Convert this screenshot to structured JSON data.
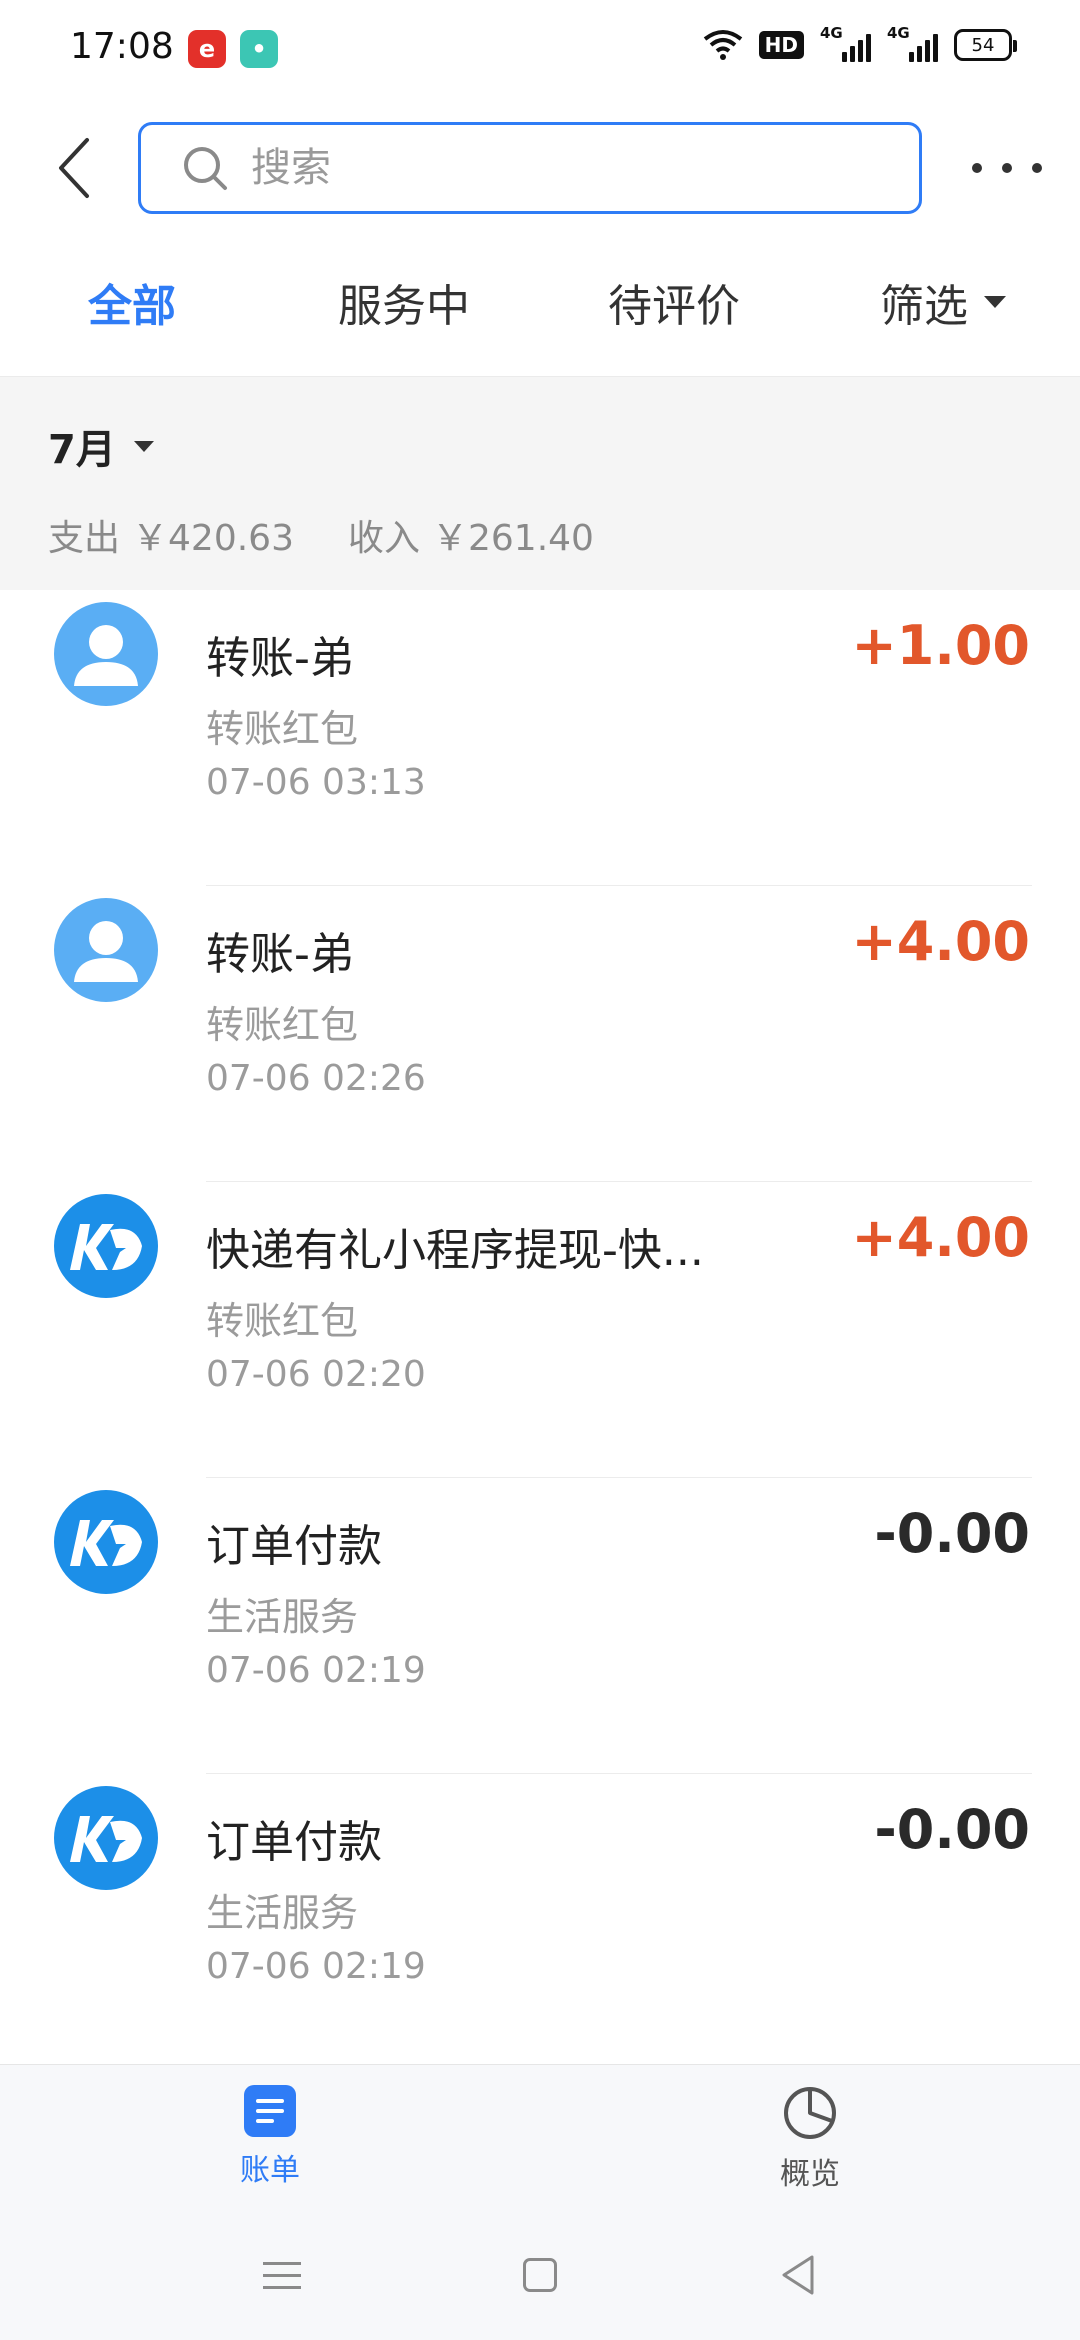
{
  "status_bar": {
    "time": "17:08",
    "badge1": "e",
    "badge2": "•",
    "hd": "HD",
    "network1": "4G",
    "network2": "4G",
    "battery": "54"
  },
  "header": {
    "search_placeholder": "搜索"
  },
  "tabs": [
    {
      "label": "全部",
      "active": true
    },
    {
      "label": "服务中",
      "active": false
    },
    {
      "label": "待评价",
      "active": false
    },
    {
      "label": "筛选",
      "active": false
    }
  ],
  "summary": {
    "month": "7月",
    "expense_label": "支出",
    "expense_value": "￥420.63",
    "income_label": "收入",
    "income_value": "￥261.40"
  },
  "transactions": [
    {
      "avatar": "person-icon",
      "title": "转账-弟",
      "category": "转账红包",
      "time": "07-06  03:13",
      "amount": "+1.00"
    },
    {
      "avatar": "person-icon",
      "title": "转账-弟",
      "category": "转账红包",
      "time": "07-06  02:26",
      "amount": "+4.00"
    },
    {
      "avatar": "kd-logo-icon",
      "title": "快递有礼小程序提现-快...",
      "category": "转账红包",
      "time": "07-06  02:20",
      "amount": "+4.00"
    },
    {
      "avatar": "kd-logo-icon",
      "title": "订单付款",
      "category": "生活服务",
      "time": "07-06  02:19",
      "amount": "-0.00"
    },
    {
      "avatar": "kd-logo-icon",
      "title": "订单付款",
      "category": "生活服务",
      "time": "07-06  02:19",
      "amount": "-0.00"
    }
  ],
  "bottom_nav": {
    "bills_label": "账单",
    "overview_label": "概览"
  },
  "colors": {
    "accent": "#2f7cf6",
    "income": "#e2572b",
    "expense": "#2a2a2a"
  }
}
